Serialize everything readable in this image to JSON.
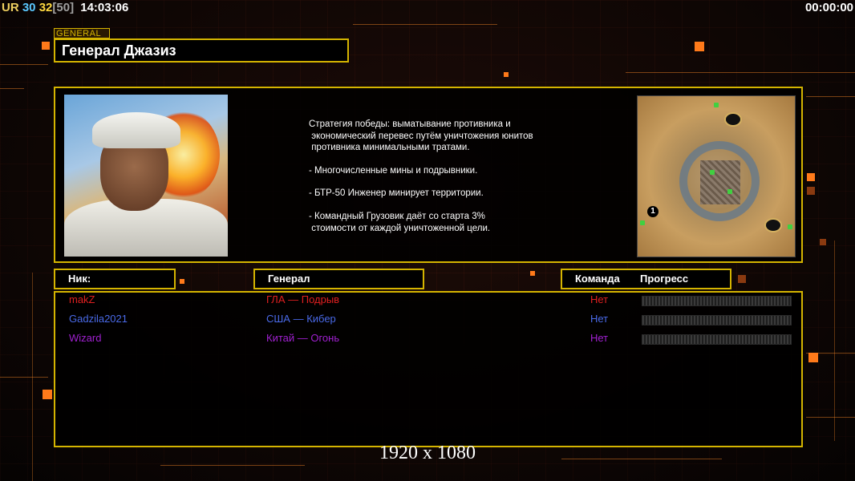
{
  "hud": {
    "rank": "UR",
    "value1": "30",
    "value2": "32",
    "value3": "[50]",
    "clock": "14:03:06",
    "timer": "00:00:00"
  },
  "general": {
    "tag": "GENERAL",
    "name": "Генерал Джазиз",
    "description": [
      "Стратегия победы: выматывание противника и",
      " экономический перевес путём уничтожения юнитов",
      " противника минимальными тратами.",
      "",
      "- Многочисленные мины и подрывники.",
      "",
      "- БТР-50 Инженер минирует территории.",
      "",
      "- Командный Грузовик даёт со старта 3%",
      " стоимости от каждой уничтоженной цели."
    ],
    "minimap_start_label": "1"
  },
  "table": {
    "headers": {
      "nick": "Ник:",
      "general": "Генерал",
      "team": "Команда",
      "progress": "Прогресс"
    },
    "players": [
      {
        "nick": "makZ",
        "general": "ГЛА — Подрыв",
        "team": "Нет",
        "color": "#e02020",
        "progress": 0
      },
      {
        "nick": "Gadzila2021",
        "general": "США — Кибер",
        "team": "Нет",
        "color": "#4a6ae8",
        "progress": 0
      },
      {
        "nick": "Wizard",
        "general": "Китай — Огонь",
        "team": "Нет",
        "color": "#a020d0",
        "progress": 0
      }
    ]
  },
  "footer": {
    "resolution": "1920 x 1080"
  },
  "colors": {
    "accent_border": "#d4b400",
    "decor_orange": "#ff7a1a"
  }
}
